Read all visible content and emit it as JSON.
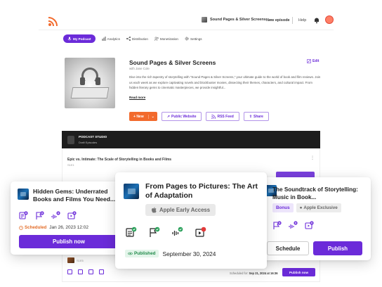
{
  "header": {
    "podcast_selector": "Sound Pages & Silver Screens",
    "new_episode": "New episode",
    "help": "Help"
  },
  "nav": {
    "items": [
      {
        "label": "My Podcast",
        "active": true
      },
      {
        "label": "Analytics"
      },
      {
        "label": "Distribution"
      },
      {
        "label": "Monetization"
      },
      {
        "label": "Settings"
      }
    ]
  },
  "podcast": {
    "title": "Sound Pages & Silver Screens",
    "author": "with Jane Cole",
    "edit": "Edit",
    "description": "Dive into the rich tapestry of storytelling with \"Sound Pages & Silver Screens,\" your ultimate guide to the world of book and film reviews. Join us each week as we explore captivating novels and blockbuster movies, dissecting their themes, characters, and cultural impact. From hidden literary gems to cinematic masterpieces, we provide insightful...",
    "read_more": "Read more"
  },
  "actions": {
    "new": "New",
    "public_website": "Public Website",
    "rss_feed": "RSS Feed",
    "share": "Share"
  },
  "studio": {
    "title": "PODCAST STUDIO",
    "subtitle": "Draft Episodes"
  },
  "episodes": {
    "first": {
      "title": "Epic vs. Intimate: The Scale of Storytelling in Books and Films",
      "tag": "S1E1"
    },
    "bottom": {
      "tag": "S1E5",
      "scheduled_prefix": "Scheduled for:",
      "scheduled_date": "Sep 21, 2024 at 16:36",
      "publish": "Publish now"
    }
  },
  "cards": {
    "left": {
      "title": "Hidden Gems: Underrated Books and Films You Need...",
      "status": "Scheduled",
      "date": "Jan 26, 2023 12:02",
      "publish": "Publish now"
    },
    "middle": {
      "title": "From Pages to Pictures: The Art of Adaptation",
      "access": "Apple Early Access",
      "status": "Published",
      "date": "September 30, 2024"
    },
    "right": {
      "title": "The Soundtrack of Storytelling: Music in Book...",
      "tag_bonus": "Bonus",
      "tag_exclusive": "Apple Exclusive",
      "schedule": "Schedule",
      "publish": "Publish"
    }
  },
  "colors": {
    "accent": "#6b2bd9",
    "orange": "#f26a2c",
    "published": "#218a4a",
    "scheduled": "#e36b26"
  }
}
